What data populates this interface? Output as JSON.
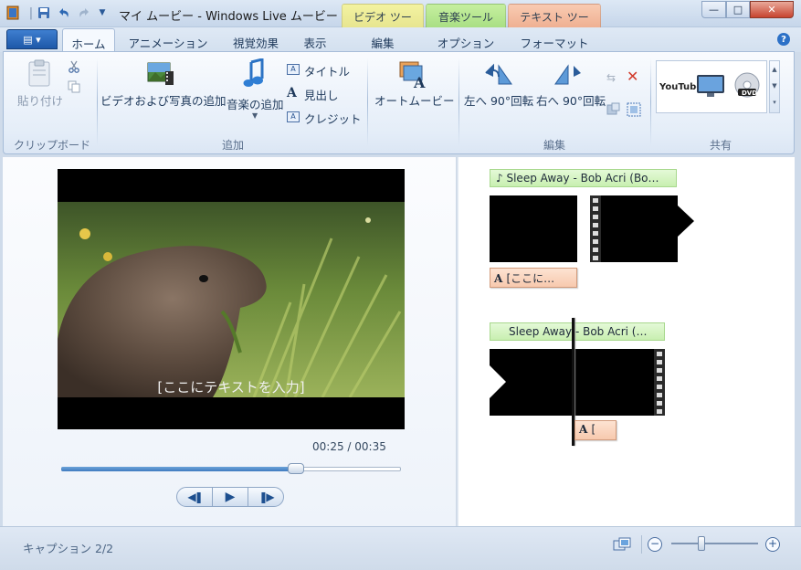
{
  "window": {
    "title": "マイ ムービー - Windows Live ムービー ...",
    "context_tabs": [
      "ビデオ ツール",
      "音楽ツール",
      "テキスト ツール"
    ],
    "minimize": "—",
    "maximize": "□",
    "close": "✕"
  },
  "tabs": [
    "ホーム",
    "アニメーション",
    "視覚効果",
    "表示",
    "編集",
    "オプション",
    "フォーマット"
  ],
  "ribbon": {
    "clipboard": {
      "paste": "貼り付け",
      "group_label": "クリップボード"
    },
    "add": {
      "add_video_photo": "ビデオおよび写真の追加",
      "add_music": "音楽の追加",
      "title": "タイトル",
      "caption": "見出し",
      "credits": "クレジット",
      "group_label": "追加"
    },
    "automovie": "オートムービー",
    "edit": {
      "rotate_left": "左へ 90°回転",
      "rotate_right": "右へ 90°回転",
      "group_label": "編集"
    },
    "share": {
      "youtube": "YouTube",
      "dvd": "DVD",
      "group_label": "共有"
    }
  },
  "preview": {
    "overlay_text": "[ここにテキストを入力]",
    "time": "00:25 / 00:35",
    "progress_fraction": 0.69
  },
  "storyboard": {
    "row1": {
      "music": "Sleep Away - Bob Acri (Bo…",
      "caption": "[ここに…"
    },
    "row2": {
      "music": "Sleep Away - Bob Acri (…",
      "caption": "["
    }
  },
  "status": {
    "caption_counter": "キャプション 2/2",
    "zoom_fraction": 0.35
  }
}
